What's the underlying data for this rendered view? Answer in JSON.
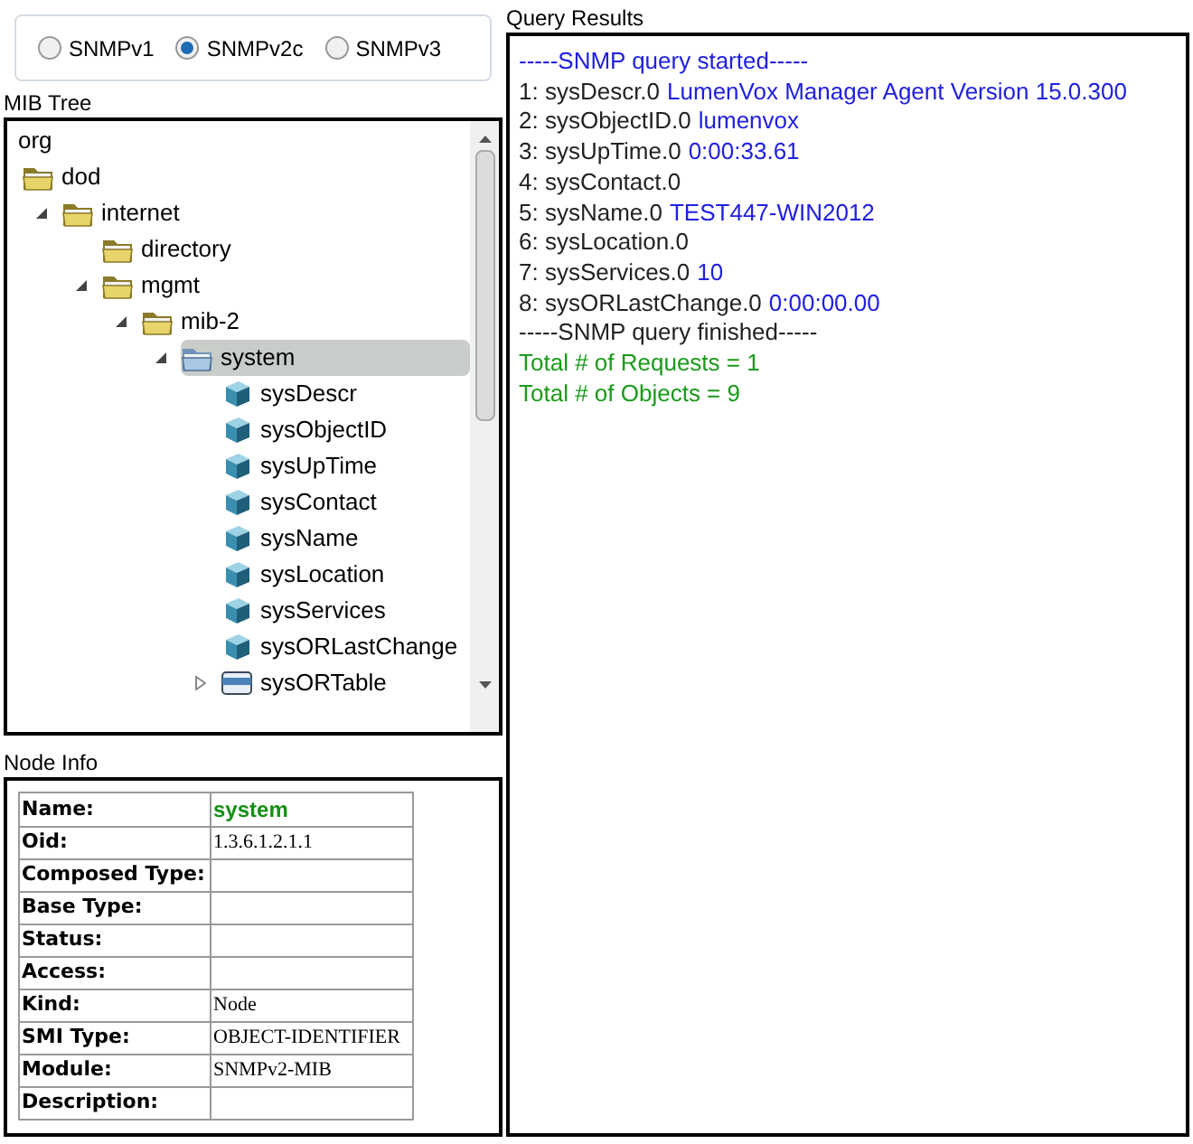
{
  "snmp_versions": [
    {
      "label": "SNMPv1",
      "selected": false
    },
    {
      "label": "SNMPv2c",
      "selected": true
    },
    {
      "label": "SNMPv3",
      "selected": false
    }
  ],
  "mib_tree": {
    "title": "MIB Tree",
    "root": {
      "label": "org",
      "selected": false,
      "children": [
        {
          "label": "dod",
          "kind": "folder",
          "selected": false,
          "children": [
            {
              "label": "internet",
              "kind": "folder",
              "expanded": true,
              "selected": false,
              "children": [
                {
                  "label": "directory",
                  "kind": "folder",
                  "selected": false
                },
                {
                  "label": "mgmt",
                  "kind": "folder",
                  "expanded": true,
                  "selected": false,
                  "children": [
                    {
                      "label": "mib-2",
                      "kind": "folder",
                      "expanded": true,
                      "selected": false,
                      "children": [
                        {
                          "label": "system",
                          "kind": "folder",
                          "expanded": true,
                          "selected": true,
                          "children": [
                            {
                              "label": "sysDescr",
                              "kind": "leaf",
                              "selected": false
                            },
                            {
                              "label": "sysObjectID",
                              "kind": "leaf",
                              "selected": false
                            },
                            {
                              "label": "sysUpTime",
                              "kind": "leaf",
                              "selected": false
                            },
                            {
                              "label": "sysContact",
                              "kind": "leaf",
                              "selected": false
                            },
                            {
                              "label": "sysName",
                              "kind": "leaf",
                              "selected": false
                            },
                            {
                              "label": "sysLocation",
                              "kind": "leaf",
                              "selected": false
                            },
                            {
                              "label": "sysServices",
                              "kind": "leaf",
                              "selected": false
                            },
                            {
                              "label": "sysORLastChange",
                              "kind": "leaf",
                              "selected": false
                            },
                            {
                              "label": "sysORTable",
                              "kind": "table",
                              "expanded": false,
                              "selected": false
                            }
                          ]
                        }
                      ]
                    }
                  ]
                }
              ]
            }
          ]
        }
      ]
    }
  },
  "node_info": {
    "title": "Node Info",
    "rows": [
      {
        "label": "Name:",
        "value": "system",
        "kind": "title"
      },
      {
        "label": "Oid:",
        "value": "1.3.6.1.2.1.1",
        "kind": "plain"
      },
      {
        "label": "Composed Type:",
        "kind": "plain"
      },
      {
        "label": "Base Type:",
        "kind": "plain"
      },
      {
        "label": "Status:",
        "kind": "plain"
      },
      {
        "label": "Access:",
        "kind": "plain"
      },
      {
        "label": "Kind:",
        "value": "Node",
        "kind": "plain"
      },
      {
        "label": "SMI Type:",
        "value": "OBJECT-IDENTIFIER",
        "kind": "plain"
      },
      {
        "label": "Module:",
        "value": "SNMPv2-MIB",
        "kind": "plain"
      },
      {
        "label": "Description:",
        "kind": "plain"
      }
    ]
  },
  "query_results": {
    "title": "Query Results",
    "lines": [
      {
        "kind": "started",
        "text": "-----SNMP query started-----"
      },
      {
        "kind": "entry",
        "text": "1: sysDescr.0",
        "value": "LumenVox Manager Agent Version 15.0.300"
      },
      {
        "kind": "entry",
        "text": "2: sysObjectID.0",
        "value": "lumenvox"
      },
      {
        "kind": "entry",
        "text": "3: sysUpTime.0",
        "value": "0:00:33.61"
      },
      {
        "kind": "entry",
        "text": "4: sysContact.0"
      },
      {
        "kind": "entry",
        "text": "5: sysName.0",
        "value": "TEST447-WIN2012"
      },
      {
        "kind": "entry",
        "text": "6: sysLocation.0"
      },
      {
        "kind": "entry",
        "text": "7: sysServices.0",
        "value": "10"
      },
      {
        "kind": "entry",
        "text": "8: sysORLastChange.0",
        "value": "0:00:00.00"
      },
      {
        "kind": "finished",
        "text": "-----SNMP query finished-----"
      },
      {
        "kind": "summary",
        "text": "Total # of Requests = 1"
      },
      {
        "kind": "summary",
        "text": "Total # of Objects = 9"
      }
    ]
  }
}
